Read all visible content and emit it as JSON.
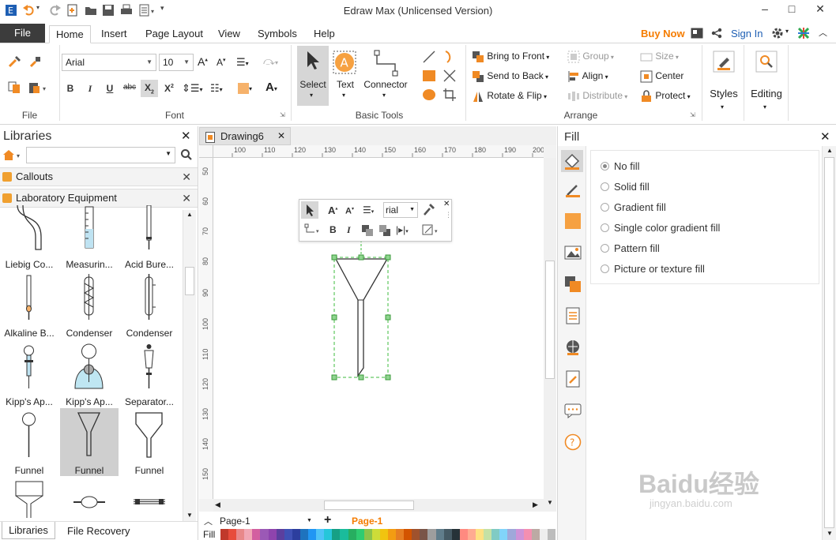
{
  "window": {
    "title": "Edraw Max (Unlicensed Version)"
  },
  "ribbon_tabs": [
    "File",
    "Home",
    "Insert",
    "Page Layout",
    "View",
    "Symbols",
    "Help"
  ],
  "header_right": {
    "buy_now": "Buy Now",
    "sign_in": "Sign In"
  },
  "font_group": {
    "font_name": "Arial",
    "font_size": "10",
    "label": "Font"
  },
  "file_group": {
    "label": "File"
  },
  "basic_tools": {
    "select": "Select",
    "text": "Text",
    "connector": "Connector",
    "label": "Basic Tools"
  },
  "arrange": {
    "bring_to_front": "Bring to Front",
    "send_to_back": "Send to Back",
    "rotate_flip": "Rotate & Flip",
    "group": "Group",
    "align": "Align",
    "distribute": "Distribute",
    "size": "Size",
    "center": "Center",
    "protect": "Protect",
    "label": "Arrange"
  },
  "styles": "Styles",
  "editing": "Editing",
  "libraries": {
    "title": "Libraries",
    "sections": [
      "Callouts",
      "Laboratory Equipment"
    ],
    "shapes": [
      "Liebig Co...",
      "Measurin...",
      "Acid Bure...",
      "Alkaline B...",
      "Condenser",
      "Condenser",
      "Kipp's Ap...",
      "Kipp's Ap...",
      "Separator...",
      "Funnel",
      "Funnel",
      "Funnel"
    ],
    "bottom_tabs": [
      "Libraries",
      "File Recovery"
    ]
  },
  "document": {
    "tab": "Drawing6",
    "ruler_h": [
      "100",
      "110",
      "120",
      "130",
      "140",
      "150",
      "160",
      "170",
      "180",
      "190",
      "200"
    ],
    "ruler_v": [
      "50",
      "60",
      "70",
      "80",
      "90",
      "100",
      "110",
      "120",
      "130",
      "140",
      "150"
    ],
    "float_font": "rial"
  },
  "pages": {
    "page_select": "Page-1",
    "active_page": "Page-1",
    "fill_label": "Fill"
  },
  "fill_panel": {
    "title": "Fill",
    "options": [
      "No fill",
      "Solid fill",
      "Gradient fill",
      "Single color gradient fill",
      "Pattern fill",
      "Picture or texture fill"
    ],
    "selected": "No fill"
  },
  "colors": {
    "accent_orange": "#f57c00",
    "selection_green": "#3dbb3d",
    "file_tab": "#3c3c3c",
    "palette": [
      "#c0392b",
      "#e74c3c",
      "#e8888a",
      "#f1a7b5",
      "#d35fa0",
      "#9b59b6",
      "#8e44ad",
      "#5b3f9e",
      "#3f51b5",
      "#2c3e9e",
      "#1e73be",
      "#2196f3",
      "#4fc3f7",
      "#26c6da",
      "#16a085",
      "#1abc9c",
      "#27ae60",
      "#2ecc71",
      "#8bc34a",
      "#cddc39",
      "#f1c40f",
      "#f39c12",
      "#e67e22",
      "#d35400",
      "#a0522d",
      "#795548",
      "#9e9e9e",
      "#607d8b",
      "#455a64",
      "#263238",
      "#ff8a80",
      "#ffab91",
      "#ffe082",
      "#c5e1a5",
      "#80cbc4",
      "#81d4fa",
      "#9fa8da",
      "#ce93d8",
      "#f48fb1",
      "#bcaaa4",
      "#eeeeee",
      "#bdbdbd"
    ]
  },
  "watermark": {
    "logo": "Baidu经验",
    "url": "jingyan.baidu.com"
  }
}
